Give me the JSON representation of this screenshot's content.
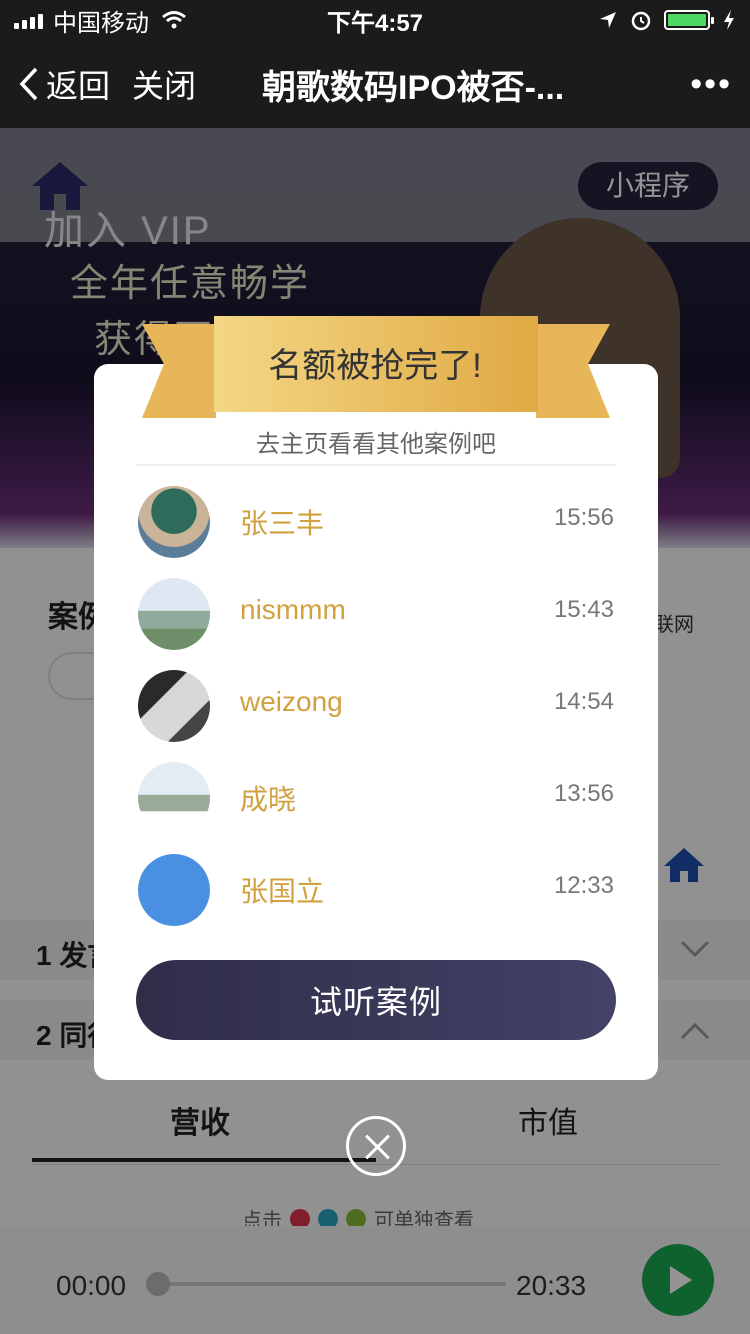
{
  "status_bar": {
    "carrier": "中国移动",
    "time": "下午4:57"
  },
  "nav": {
    "back_label": "返回",
    "close_label": "关闭",
    "title": "朝歌数码IPO被否-...",
    "more": "•••"
  },
  "banner": {
    "line1": "加入 VIP",
    "line2": "全年任意畅学",
    "line3": "获得更多海内干货",
    "mini_program_badge": "小程序"
  },
  "page": {
    "case_title": "案例",
    "case_source": "联网",
    "section1": "1 发言",
    "section2": "2 同行",
    "tabs": [
      "营收",
      "市值"
    ],
    "legend_prefix": "点击",
    "legend_suffix": "可单独查看",
    "legend_colors": [
      "#e0344b",
      "#2aa8c4",
      "#8bbb3a"
    ]
  },
  "player": {
    "current": "00:00",
    "duration": "20:33",
    "progress": 0
  },
  "modal": {
    "title": "名额被抢完了!",
    "subtitle": "去主页看看其他案例吧",
    "users": [
      {
        "name": "张三丰",
        "time": "15:56"
      },
      {
        "name": "nismmm",
        "time": "15:43"
      },
      {
        "name": "weizong",
        "time": "14:54"
      },
      {
        "name": "成晓",
        "time": "13:56"
      },
      {
        "name": "张国立",
        "time": "12:33"
      }
    ],
    "cta_label": "试听案例"
  },
  "colors": {
    "accent_gold": "#d2a13f",
    "button_dark": "#2f2d48",
    "play_green": "#1aa84e"
  }
}
